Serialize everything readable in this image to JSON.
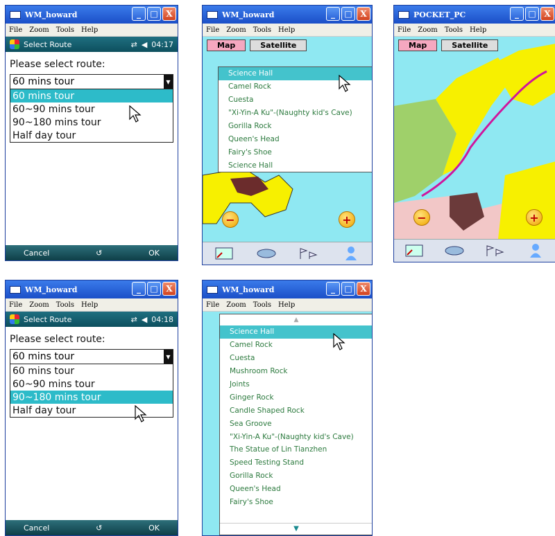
{
  "colors": {
    "teal_select": "#2dbbc9",
    "map_water": "#8fe8f2",
    "map_land": "#f7f000",
    "title_blue": "#2a62d8"
  },
  "window_controls": {
    "minimize": "_",
    "maximize": "□",
    "close": "X"
  },
  "screens": [
    {
      "title": "WM_howard",
      "menu": [
        "File",
        "Zoom",
        "Tools",
        "Help"
      ],
      "status": {
        "app": "Select Route",
        "time": "04:17"
      },
      "prompt": "Please select route:",
      "combo_value": "60 mins tour",
      "options": [
        "60 mins tour",
        "60~90 mins tour",
        "90~180 mins tour",
        "Half day tour"
      ],
      "selected_index": 0,
      "softkeys": {
        "left": "Cancel",
        "right": "OK"
      }
    },
    {
      "title": "WM_howard",
      "menu": [
        "File",
        "Zoom",
        "Tools",
        "Help"
      ],
      "buttons": {
        "map": "Map",
        "satellite": "Satellite"
      },
      "popup": [
        "Science Hall",
        "Camel Rock",
        "Cuesta",
        "\"Xi-Yin-A Ku\"-(Naughty kid's Cave)",
        "Gorilla Rock",
        "Queen's Head",
        "Fairy's Shoe",
        "Science Hall"
      ],
      "zoom_out": "−",
      "zoom_in": "+"
    },
    {
      "title": "POCKET_PC",
      "menu": [
        "File",
        "Zoom",
        "Tools",
        "Help"
      ],
      "buttons": {
        "map": "Map",
        "satellite": "Satellite"
      },
      "zoom_out": "−",
      "zoom_in": "+"
    },
    {
      "title": "WM_howard",
      "menu": [
        "File",
        "Zoom",
        "Tools",
        "Help"
      ],
      "status": {
        "app": "Select Route",
        "time": "04:18"
      },
      "prompt": "Please select route:",
      "combo_value": "60 mins tour",
      "options": [
        "60 mins tour",
        "60~90 mins tour",
        "90~180 mins tour",
        "Half day tour"
      ],
      "selected_index": 2,
      "softkeys": {
        "left": "Cancel",
        "right": "OK"
      }
    },
    {
      "title": "WM_howard",
      "menu": [
        "File",
        "Zoom",
        "Tools",
        "Help"
      ],
      "popup": [
        "Science Hall",
        "Camel Rock",
        "Cuesta",
        "Mushroom Rock",
        "Joints",
        "Ginger Rock",
        "Candle Shaped Rock",
        "Sea Groove",
        "\"Xi-Yin-A Ku\"-(Naughty kid's Cave)",
        "The Statue of Lin Tianzhen",
        "Speed Testing Stand",
        "Gorilla Rock",
        "Queen's Head",
        "Fairy's Shoe"
      ]
    }
  ]
}
